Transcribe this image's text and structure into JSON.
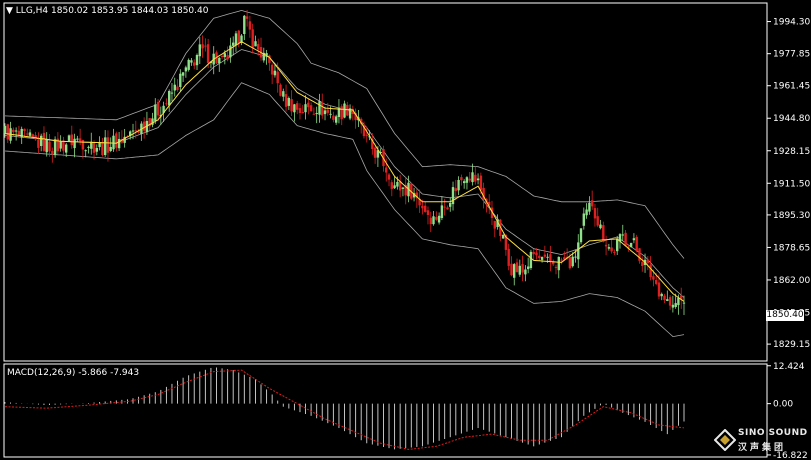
{
  "header": {
    "symbol_line": "LLG,H4  1850.02 1853.95 1844.03 1850.40"
  },
  "macd_header": "MACD(12,26,9) -5.866 -7.943",
  "current_price": "1850.40",
  "logo": {
    "name": "SINO SOUND",
    "name_cn": "汉声集团"
  },
  "colors": {
    "background": "#000000",
    "bull": "#8fe08a",
    "bear": "#e02020",
    "bollinger": "#a8a8a8",
    "ma": "#ffe040",
    "signal": "#e01c1c",
    "histogram": "#d8d8d8",
    "axis": "#ffffff"
  },
  "chart_data": [
    {
      "type": "candlestick",
      "title": "LLG,H4",
      "ylim": [
        1820.5,
        2003.8
      ],
      "y_ticks": [
        "1994.30",
        "1977.85",
        "1961.45",
        "1944.80",
        "1928.15",
        "1911.50",
        "1895.30",
        "1878.65",
        "1862.00",
        "1845.35",
        "1829.15"
      ],
      "y_tick_values": [
        1994.3,
        1977.85,
        1961.45,
        1944.8,
        1928.15,
        1911.5,
        1895.3,
        1878.65,
        1862.0,
        1845.35,
        1829.15
      ],
      "last_bar": {
        "open": 1850.02,
        "high": 1853.95,
        "low": 1844.03,
        "close": 1850.4
      },
      "close_path": [
        [
          0,
          1938
        ],
        [
          10,
          1933
        ],
        [
          18,
          1930
        ],
        [
          25,
          1934
        ],
        [
          35,
          1930
        ],
        [
          45,
          1936
        ],
        [
          52,
          1945
        ],
        [
          58,
          1953
        ],
        [
          64,
          1967
        ],
        [
          70,
          1979
        ],
        [
          74,
          1977
        ],
        [
          78,
          1973
        ],
        [
          82,
          1980
        ],
        [
          86,
          1995
        ],
        [
          90,
          1982
        ],
        [
          96,
          1970
        ],
        [
          100,
          1955
        ],
        [
          106,
          1949
        ],
        [
          112,
          1951
        ],
        [
          118,
          1946
        ],
        [
          124,
          1951
        ],
        [
          130,
          1933
        ],
        [
          136,
          1922
        ],
        [
          140,
          1910
        ],
        [
          146,
          1908
        ],
        [
          150,
          1900
        ],
        [
          154,
          1893
        ],
        [
          158,
          1900
        ],
        [
          162,
          1910
        ],
        [
          166,
          1918
        ],
        [
          170,
          1912
        ],
        [
          174,
          1898
        ],
        [
          178,
          1886
        ],
        [
          182,
          1869
        ],
        [
          186,
          1866
        ],
        [
          190,
          1875
        ],
        [
          194,
          1870
        ],
        [
          200,
          1872
        ],
        [
          204,
          1870
        ],
        [
          208,
          1892
        ],
        [
          211,
          1902
        ],
        [
          214,
          1888
        ],
        [
          218,
          1876
        ],
        [
          222,
          1884
        ],
        [
          226,
          1880
        ],
        [
          230,
          1870
        ],
        [
          234,
          1860
        ],
        [
          238,
          1851
        ],
        [
          240,
          1847
        ],
        [
          242,
          1852
        ],
        [
          244,
          1850.4
        ]
      ],
      "bollinger_bands": {
        "period": 20,
        "upper": [
          [
            0,
            1946
          ],
          [
            20,
            1945
          ],
          [
            40,
            1944
          ],
          [
            55,
            1952
          ],
          [
            65,
            1978
          ],
          [
            75,
            1996
          ],
          [
            85,
            2000
          ],
          [
            95,
            1996
          ],
          [
            105,
            1983
          ],
          [
            110,
            1973
          ],
          [
            120,
            1968
          ],
          [
            130,
            1960
          ],
          [
            140,
            1937
          ],
          [
            150,
            1920
          ],
          [
            160,
            1921
          ],
          [
            170,
            1920
          ],
          [
            180,
            1915
          ],
          [
            190,
            1905
          ],
          [
            200,
            1902
          ],
          [
            210,
            1902
          ],
          [
            220,
            1903
          ],
          [
            230,
            1900
          ],
          [
            240,
            1880
          ],
          [
            244,
            1873
          ]
        ],
        "middle": [
          [
            0,
            1936
          ],
          [
            20,
            1933
          ],
          [
            40,
            1932
          ],
          [
            55,
            1940
          ],
          [
            65,
            1957
          ],
          [
            75,
            1971
          ],
          [
            85,
            1980
          ],
          [
            95,
            1976
          ],
          [
            105,
            1960
          ],
          [
            115,
            1952
          ],
          [
            125,
            1948
          ],
          [
            130,
            1940
          ],
          [
            140,
            1920
          ],
          [
            150,
            1906
          ],
          [
            160,
            1904
          ],
          [
            170,
            1906
          ],
          [
            180,
            1888
          ],
          [
            190,
            1878
          ],
          [
            200,
            1875
          ],
          [
            210,
            1880
          ],
          [
            220,
            1884
          ],
          [
            230,
            1874
          ],
          [
            240,
            1858
          ],
          [
            244,
            1853
          ]
        ],
        "lower": [
          [
            0,
            1928
          ],
          [
            20,
            1926
          ],
          [
            40,
            1924
          ],
          [
            55,
            1926
          ],
          [
            65,
            1936
          ],
          [
            75,
            1944
          ],
          [
            85,
            1963
          ],
          [
            95,
            1957
          ],
          [
            105,
            1941
          ],
          [
            115,
            1937
          ],
          [
            125,
            1934
          ],
          [
            130,
            1918
          ],
          [
            140,
            1898
          ],
          [
            150,
            1883
          ],
          [
            160,
            1880
          ],
          [
            170,
            1878
          ],
          [
            180,
            1858
          ],
          [
            190,
            1850
          ],
          [
            200,
            1851
          ],
          [
            210,
            1855
          ],
          [
            220,
            1853
          ],
          [
            230,
            1846
          ],
          [
            240,
            1833
          ],
          [
            244,
            1834
          ]
        ]
      },
      "ma_line": [
        [
          0,
          1937
        ],
        [
          20,
          1933
        ],
        [
          40,
          1932
        ],
        [
          55,
          1944
        ],
        [
          65,
          1962
        ],
        [
          75,
          1975
        ],
        [
          85,
          1984
        ],
        [
          95,
          1976
        ],
        [
          105,
          1958
        ],
        [
          115,
          1950
        ],
        [
          125,
          1949
        ],
        [
          130,
          1938
        ],
        [
          140,
          1915
        ],
        [
          150,
          1902
        ],
        [
          160,
          1902
        ],
        [
          170,
          1910
        ],
        [
          180,
          1884
        ],
        [
          190,
          1872
        ],
        [
          200,
          1871
        ],
        [
          210,
          1882
        ],
        [
          220,
          1883
        ],
        [
          230,
          1871
        ],
        [
          240,
          1855
        ],
        [
          244,
          1851
        ]
      ]
    },
    {
      "type": "macd",
      "title": "MACD(12,26,9)",
      "params": [
        12,
        26,
        9
      ],
      "macd_value": -5.866,
      "signal_value": -7.943,
      "ylim": [
        -17.5,
        13.0
      ],
      "y_ticks": [
        "12.424",
        "0.00",
        "-16.822"
      ],
      "y_tick_values": [
        12.424,
        0.0,
        -16.822
      ],
      "histogram_path": [
        [
          0,
          0.5
        ],
        [
          15,
          -0.5
        ],
        [
          30,
          0.2
        ],
        [
          45,
          1.5
        ],
        [
          55,
          4
        ],
        [
          65,
          9
        ],
        [
          75,
          12
        ],
        [
          82,
          11
        ],
        [
          90,
          8
        ],
        [
          96,
          3
        ],
        [
          100,
          -1
        ],
        [
          110,
          -4
        ],
        [
          120,
          -8
        ],
        [
          130,
          -13
        ],
        [
          140,
          -15
        ],
        [
          150,
          -14
        ],
        [
          160,
          -11
        ],
        [
          170,
          -8
        ],
        [
          180,
          -11
        ],
        [
          190,
          -14
        ],
        [
          200,
          -11
        ],
        [
          208,
          -4
        ],
        [
          215,
          0
        ],
        [
          222,
          -3
        ],
        [
          230,
          -6
        ],
        [
          238,
          -10
        ],
        [
          244,
          -5.866
        ]
      ],
      "signal_path": [
        [
          0,
          -1
        ],
        [
          15,
          -1.5
        ],
        [
          30,
          -0.5
        ],
        [
          45,
          0.8
        ],
        [
          55,
          3
        ],
        [
          65,
          7
        ],
        [
          75,
          10.5
        ],
        [
          85,
          11
        ],
        [
          95,
          5
        ],
        [
          105,
          0
        ],
        [
          115,
          -5
        ],
        [
          125,
          -9
        ],
        [
          135,
          -13
        ],
        [
          145,
          -15
        ],
        [
          155,
          -14
        ],
        [
          165,
          -11
        ],
        [
          175,
          -10
        ],
        [
          185,
          -12
        ],
        [
          195,
          -12
        ],
        [
          205,
          -7
        ],
        [
          215,
          -1
        ],
        [
          225,
          -3
        ],
        [
          235,
          -7
        ],
        [
          244,
          -7.943
        ]
      ]
    }
  ]
}
